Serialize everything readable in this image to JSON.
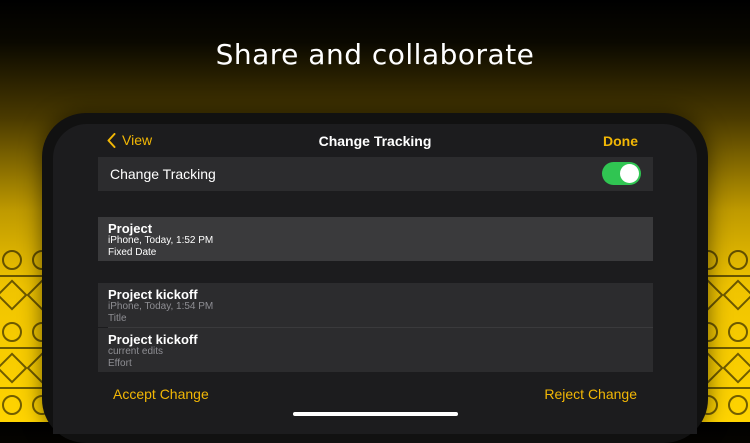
{
  "headline": "Share and collaborate",
  "navbar": {
    "back_label": "View",
    "title": "Change Tracking",
    "done_label": "Done"
  },
  "tracking": {
    "label": "Change Tracking",
    "enabled": true
  },
  "changes": [
    {
      "title": "Project",
      "subtitle": "iPhone, Today, 1:52 PM",
      "field": "Fixed Date"
    },
    {
      "title": "Project kickoff",
      "subtitle": "iPhone, Today, 1:54 PM",
      "field": "Title"
    },
    {
      "title": "Project kickoff",
      "subtitle": "current edits",
      "field": "Effort"
    }
  ],
  "toolbar": {
    "accept_label": "Accept Change",
    "reject_label": "Reject Change"
  },
  "colors": {
    "accent": "#f2b705",
    "switch_on": "#30c552",
    "background_top": "#000000",
    "background_bottom": "#ffd400"
  }
}
